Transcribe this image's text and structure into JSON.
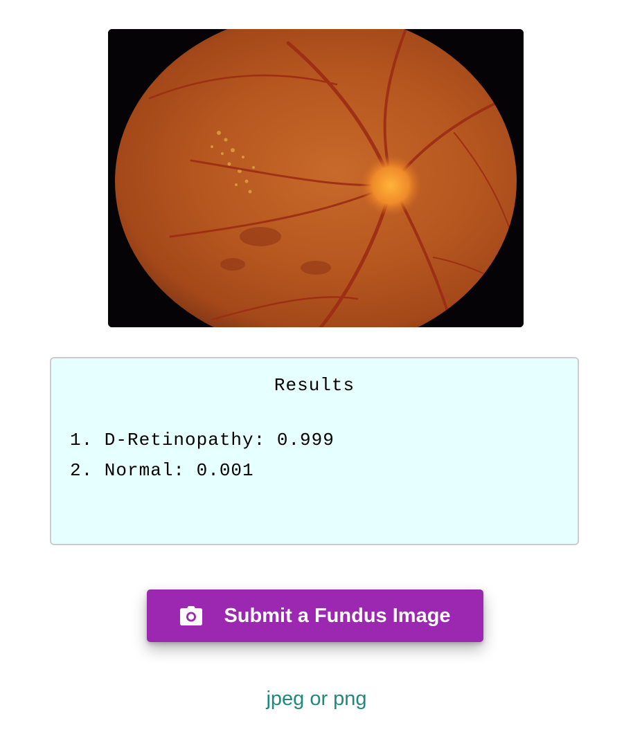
{
  "fundus_image": {
    "icon": "retinal-fundus-photo"
  },
  "results": {
    "title": "Results",
    "items": [
      "1. D-Retinopathy: 0.999",
      "2. Normal: 0.001"
    ],
    "background": "#e6ffff"
  },
  "submit": {
    "label": "Submit a Fundus Image",
    "icon": "camera-icon",
    "color": "#9c27b0"
  },
  "file_hint": {
    "text": "jpeg or png",
    "color": "#1e8a7a"
  }
}
